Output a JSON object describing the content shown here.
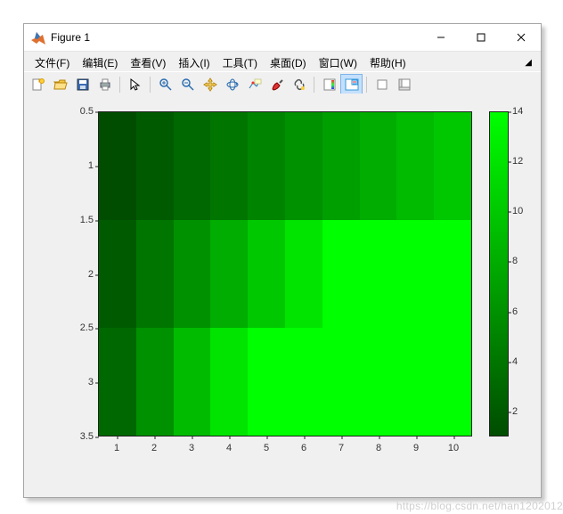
{
  "window": {
    "title": "Figure 1"
  },
  "menu": {
    "items": [
      "文件(F)",
      "编辑(E)",
      "查看(V)",
      "插入(I)",
      "工具(T)",
      "桌面(D)",
      "窗口(W)",
      "帮助(H)"
    ]
  },
  "toolbar": {
    "items": [
      {
        "name": "new-figure-icon"
      },
      {
        "name": "open-icon"
      },
      {
        "name": "save-icon"
      },
      {
        "name": "print-icon"
      },
      {
        "sep": true
      },
      {
        "name": "pointer-icon"
      },
      {
        "sep": true
      },
      {
        "name": "zoom-in-icon"
      },
      {
        "name": "zoom-out-icon"
      },
      {
        "name": "pan-icon"
      },
      {
        "name": "rotate-3d-icon"
      },
      {
        "name": "data-cursor-icon"
      },
      {
        "name": "brush-icon"
      },
      {
        "name": "link-icon"
      },
      {
        "sep": true
      },
      {
        "name": "colorbar-icon"
      },
      {
        "name": "legend-icon",
        "active": true
      },
      {
        "sep": true
      },
      {
        "name": "hide-plot-tools-icon"
      },
      {
        "name": "show-plot-tools-icon"
      }
    ]
  },
  "chart_data": {
    "type": "heatmap",
    "rows": 3,
    "cols": 10,
    "x_range": [
      0.5,
      10.5
    ],
    "y_range": [
      0.5,
      3.5
    ],
    "x_ticks": [
      1,
      2,
      3,
      4,
      5,
      6,
      7,
      8,
      9,
      10
    ],
    "y_ticks": [
      0.5,
      1,
      1.5,
      2,
      2.5,
      3,
      3.5
    ],
    "colorbar_range": [
      1,
      14
    ],
    "colorbar_ticks": [
      2,
      4,
      6,
      8,
      10,
      12,
      14
    ],
    "values": [
      [
        1,
        2,
        3,
        4,
        5,
        6,
        7,
        8,
        9,
        10
      ],
      [
        2,
        4,
        6,
        8,
        10,
        12,
        14,
        14,
        14,
        14
      ],
      [
        3,
        6,
        9,
        12,
        14,
        14,
        14,
        14,
        14,
        14
      ]
    ],
    "colormap_low": "#004d00",
    "colormap_high": "#00ff00"
  },
  "watermark": "https://blog.csdn.net/han1202012"
}
